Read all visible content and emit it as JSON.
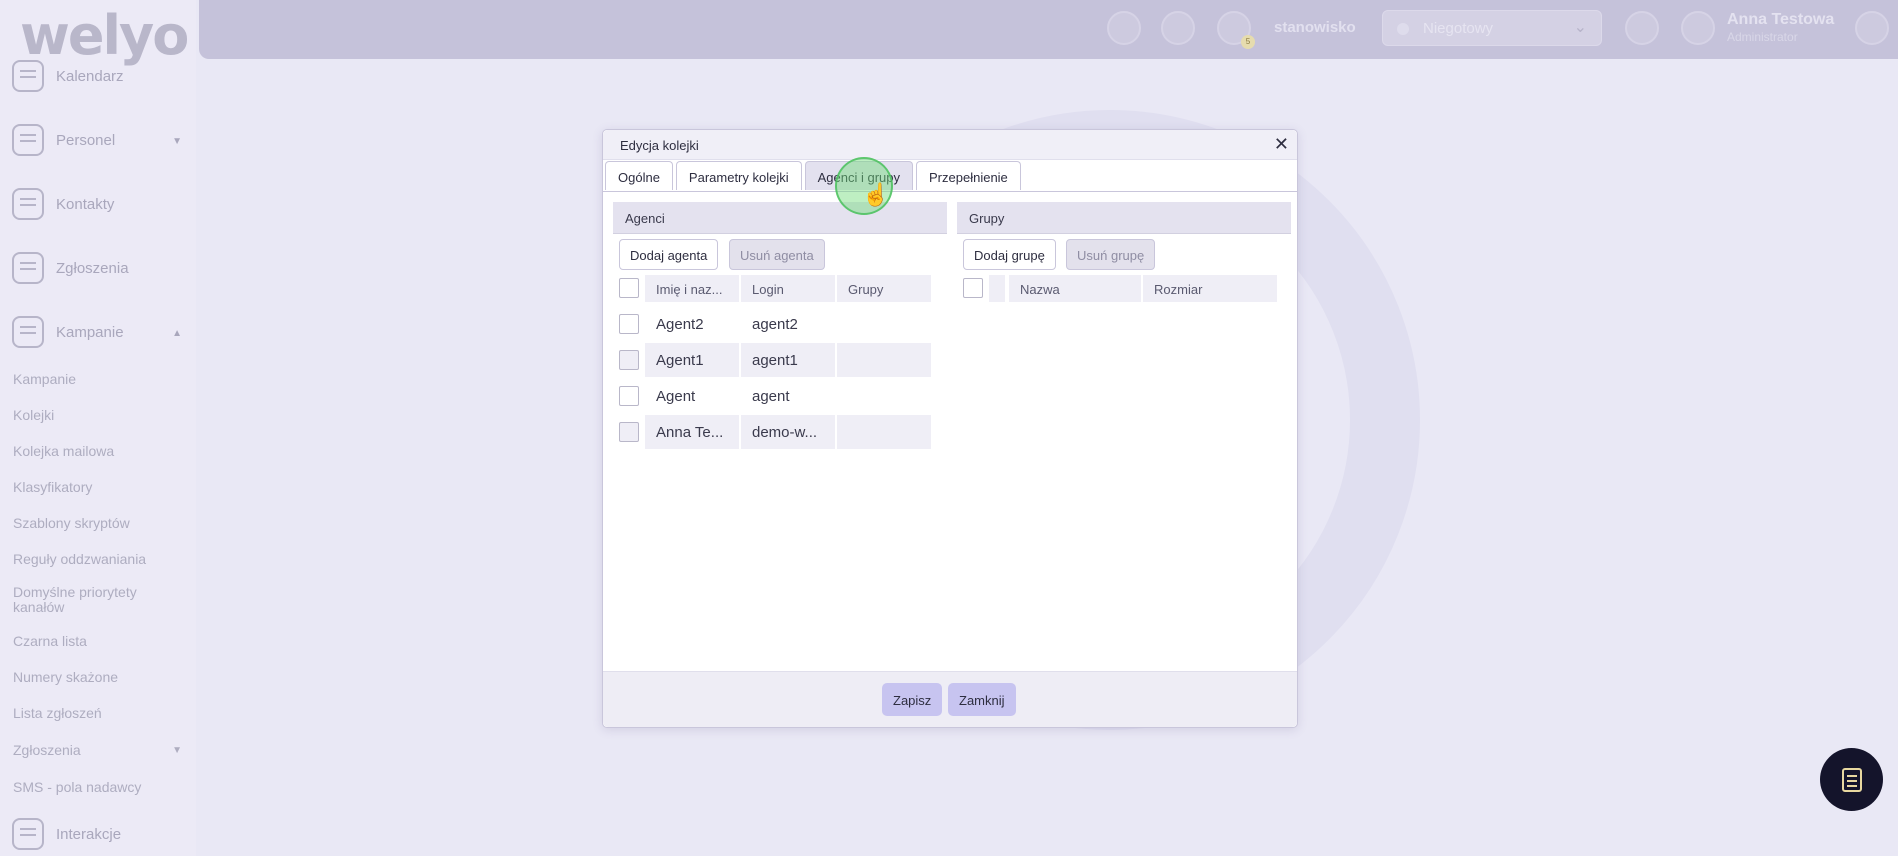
{
  "app": {
    "logo": "welyo"
  },
  "sidebar": {
    "main": [
      {
        "label": "Kalendarz",
        "icon": "calendar-icon"
      },
      {
        "label": "Personel",
        "icon": "people-icon",
        "caret": "▼"
      },
      {
        "label": "Kontakty",
        "icon": "contacts-icon"
      },
      {
        "label": "Zgłoszenia",
        "icon": "tickets-icon"
      },
      {
        "label": "Kampanie",
        "icon": "campaign-icon",
        "caret": "▲"
      }
    ],
    "sub": [
      "Kampanie",
      "Kolejki",
      "Kolejka mailowa",
      "Klasyfikatory",
      "Szablony skryptów",
      "Reguły oddzwaniania",
      "Domyślne priorytety kanałów",
      "Czarna lista",
      "Numery skażone",
      "Lista zgłoszeń",
      "Zgłoszenia",
      "SMS - pola nadawcy"
    ],
    "sub_caret": "▼",
    "bottom": {
      "label": "Interakcje",
      "icon": "interactions-icon"
    }
  },
  "topbar": {
    "workstation": "stanowisko",
    "status": "Niegotowy",
    "badge": "5",
    "user": {
      "name": "Anna Testowa",
      "role": "Administrator"
    }
  },
  "dialog": {
    "title": "Edycja kolejki",
    "close": "✕",
    "tabs": [
      "Ogólne",
      "Parametry kolejki",
      "Agenci i grupy",
      "Przepełnienie"
    ],
    "active_tab": "Agenci i grupy",
    "agents": {
      "header": "Agenci",
      "add": "Dodaj agenta",
      "remove": "Usuń agenta",
      "columns": [
        "Imię i naz...",
        "Login",
        "Grupy"
      ],
      "rows": [
        {
          "name": "Agent2",
          "login": "agent2",
          "groups": ""
        },
        {
          "name": "Agent1",
          "login": "agent1",
          "groups": ""
        },
        {
          "name": "Agent",
          "login": "agent",
          "groups": ""
        },
        {
          "name": "Anna Te...",
          "login": "demo-w...",
          "groups": ""
        }
      ]
    },
    "groups": {
      "header": "Grupy",
      "add": "Dodaj grupę",
      "remove": "Usuń grupę",
      "columns": [
        "Nazwa",
        "Rozmiar"
      ]
    },
    "save": "Zapisz",
    "close_button": "Zamknij"
  }
}
